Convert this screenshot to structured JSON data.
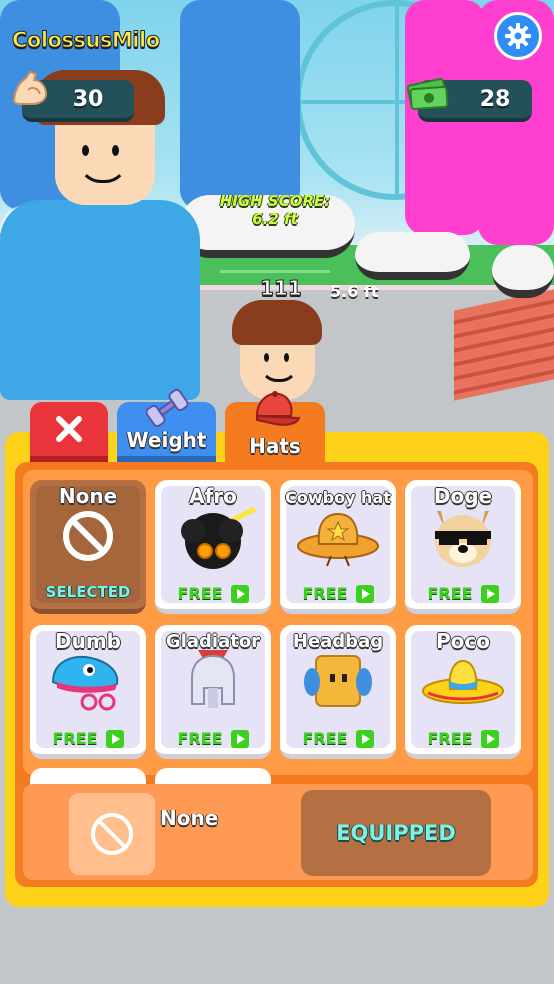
{
  "hud": {
    "player_name": "ColossusMilo",
    "strength_value": "30",
    "cash_value": "28",
    "high_score_label": "HIGH SCORE:",
    "high_score_value": "6.2 ft",
    "distance_label": "5.6 ft",
    "counter": "111",
    "icons": [
      "muscle-icon",
      "cash-icon",
      "gear-icon"
    ]
  },
  "tabs": [
    {
      "label": "",
      "icon": "close-icon"
    },
    {
      "label": "Weight",
      "icon": "dumbbell-icon"
    },
    {
      "label": "Hats",
      "icon": "cap-icon"
    }
  ],
  "items": [
    {
      "name": "None",
      "status": "SELECTED",
      "icon": "no-icon"
    },
    {
      "name": "Afro",
      "price": "FREE",
      "icon": "afro-icon"
    },
    {
      "name": "Cowboy hat",
      "price": "FREE",
      "icon": "cowboy-hat-icon"
    },
    {
      "name": "Doge",
      "price": "FREE",
      "icon": "doge-icon"
    },
    {
      "name": "Dumb",
      "price": "FREE",
      "icon": "dumb-hat-icon"
    },
    {
      "name": "Gladiator",
      "price": "FREE",
      "icon": "gladiator-helmet-icon"
    },
    {
      "name": "Headbag",
      "price": "FREE",
      "icon": "headbag-icon"
    },
    {
      "name": "Poco",
      "price": "FREE",
      "icon": "sombrero-icon"
    }
  ],
  "footer": {
    "equipped_name": "None",
    "button_label": "EQUIPPED"
  },
  "colors": {
    "panel": "#ffd21a",
    "panel_inner": "#f47b1f",
    "free_green": "#3bd11e",
    "selected_cyan": "#7ff0e4",
    "close_red": "#e8343a",
    "weight_blue": "#3f8ff0"
  }
}
